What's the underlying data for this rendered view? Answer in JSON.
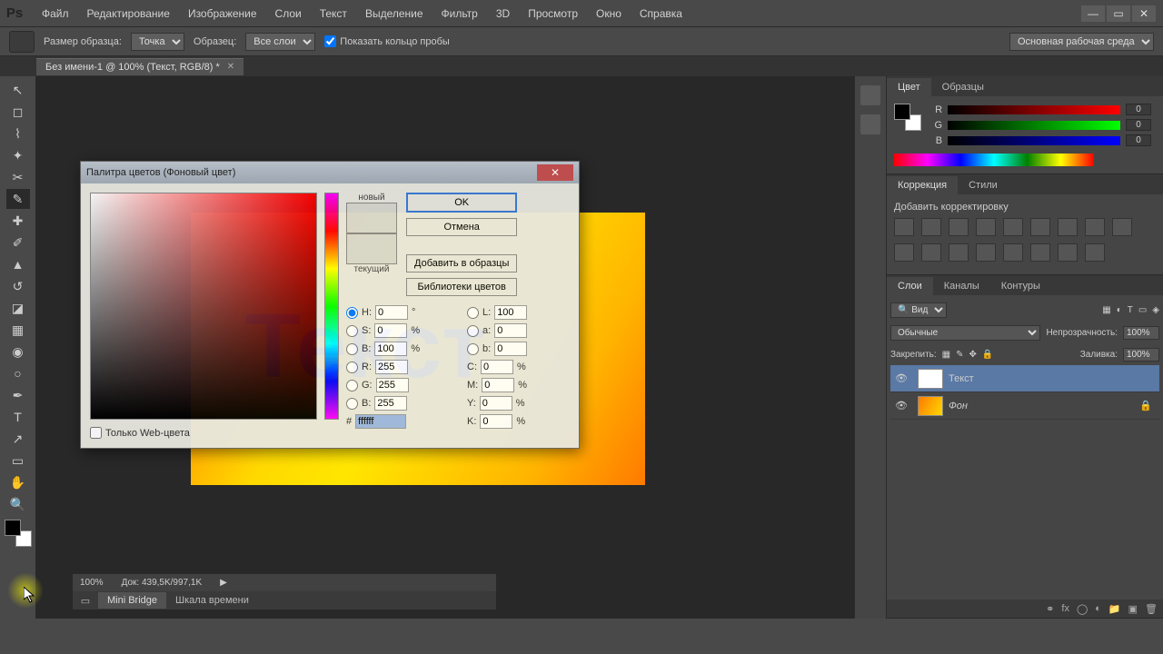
{
  "menubar": {
    "logo": "Ps",
    "items": [
      "Файл",
      "Редактирование",
      "Изображение",
      "Слои",
      "Текст",
      "Выделение",
      "Фильтр",
      "3D",
      "Просмотр",
      "Окно",
      "Справка"
    ]
  },
  "options_bar": {
    "sample_size_label": "Размер образца:",
    "sample_size_value": "Точка",
    "sample_label": "Образец:",
    "sample_value": "Все слои",
    "show_ring_label": "Показать кольцо пробы",
    "workspace": "Основная рабочая среда"
  },
  "document_tab": {
    "title": "Без имени-1 @ 100% (Текст, RGB/8) *"
  },
  "canvas": {
    "text": "Текст"
  },
  "color_picker": {
    "title": "Палитра цветов (Фоновый цвет)",
    "new_label": "новый",
    "current_label": "текущий",
    "ok": "OK",
    "cancel": "Отмена",
    "add_swatch": "Добавить в образцы",
    "color_libs": "Библиотеки цветов",
    "H": "0",
    "H_unit": "°",
    "S": "0",
    "S_unit": "%",
    "Bv": "100",
    "Bv_unit": "%",
    "R": "255",
    "G": "255",
    "B": "255",
    "L": "100",
    "a": "0",
    "b": "0",
    "C": "0",
    "C_unit": "%",
    "M": "0",
    "M_unit": "%",
    "Y": "0",
    "Y_unit": "%",
    "K": "0",
    "K_unit": "%",
    "hex_label": "#",
    "hex": "ffffff",
    "web_only": "Только Web-цвета"
  },
  "panels": {
    "color_tab": "Цвет",
    "swatches_tab": "Образцы",
    "R_label": "R",
    "R_val": "0",
    "G_label": "G",
    "G_val": "0",
    "B_label": "B",
    "B_val": "0",
    "adjustments_tab": "Коррекция",
    "styles_tab": "Стили",
    "add_adjustment": "Добавить корректировку",
    "layers_tab": "Слои",
    "channels_tab": "Каналы",
    "paths_tab": "Контуры",
    "kind_label": "Вид",
    "blend_mode": "Обычные",
    "opacity_label": "Непрозрачность:",
    "opacity_val": "100%",
    "lock_label": "Закрепить:",
    "fill_label": "Заливка:",
    "fill_val": "100%",
    "layer1_name": "Текст",
    "layer2_name": "Фон"
  },
  "status": {
    "zoom": "100%",
    "doc": "Док: 439,5K/997,1K"
  },
  "bottom_tabs": {
    "minibridge": "Mini Bridge",
    "timeline": "Шкала времени"
  },
  "chart_data": null
}
